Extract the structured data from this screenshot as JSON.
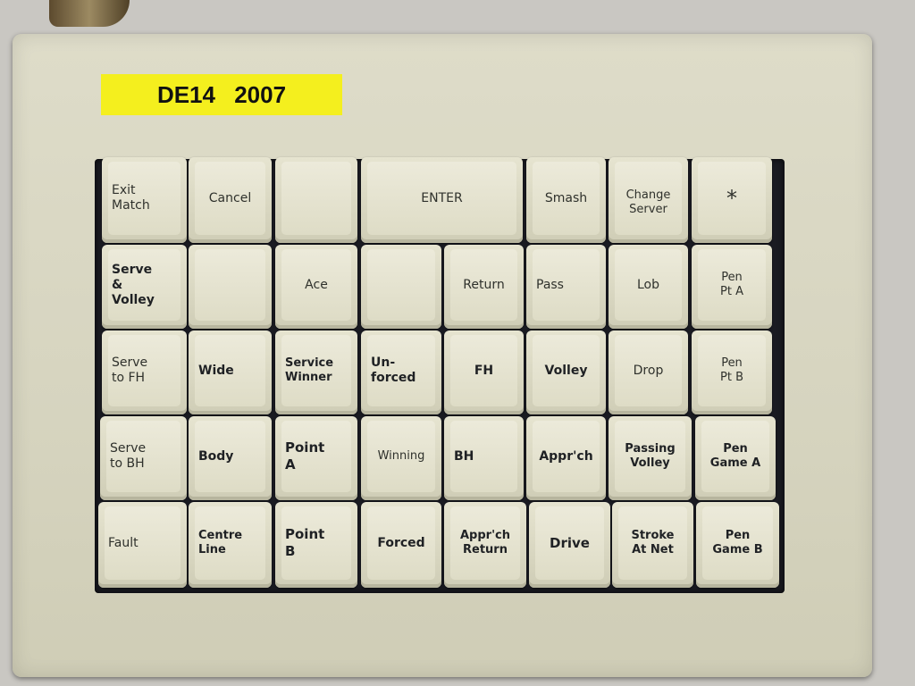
{
  "label": {
    "text": "DE14  2007"
  },
  "keys": {
    "exit_match": {
      "text": "Exit\nMatch",
      "mark": "*"
    },
    "cancel": {
      "text": "Cancel"
    },
    "enter": {
      "text": "ENTER"
    },
    "smash": {
      "text": "Smash"
    },
    "change_server": {
      "text": "Change\nServer",
      "mark": "*"
    },
    "star": {
      "text": "*"
    },
    "serve_volley": {
      "text": "Serve\n&\nVolley"
    },
    "ace": {
      "text": "Ace"
    },
    "return": {
      "text": "Return"
    },
    "pass": {
      "text": "Pass"
    },
    "lob": {
      "text": "Lob"
    },
    "pen_pt_a": {
      "text": "Pen\nPt A"
    },
    "serve_fh": {
      "text": "Serve\nto FH"
    },
    "wide": {
      "text": "Wide"
    },
    "service_winner": {
      "text": "Service\nWinner"
    },
    "unforced": {
      "text": "Un-\nforced"
    },
    "fh": {
      "text": "FH"
    },
    "volley": {
      "text": "Volley"
    },
    "drop": {
      "text": "Drop"
    },
    "pen_pt_b": {
      "text": "Pen\nPt B"
    },
    "serve_bh": {
      "text": "Serve\nto BH"
    },
    "body": {
      "text": "Body"
    },
    "point_a": {
      "text": "Point\nA"
    },
    "winning": {
      "text": "Winning"
    },
    "bh": {
      "text": "BH"
    },
    "approach": {
      "text": "Appr'ch"
    },
    "passing_volley": {
      "text": "Passing\nVolley"
    },
    "pen_game_a": {
      "text": "Pen\nGame A"
    },
    "fault": {
      "text": "Fault"
    },
    "centre_line": {
      "text": "Centre\nLine"
    },
    "point_b": {
      "text": "Point\nB"
    },
    "forced": {
      "text": "Forced"
    },
    "approach_return": {
      "text": "Appr'ch\nReturn"
    },
    "drive": {
      "text": "Drive"
    },
    "stroke_at_net": {
      "text": "Stroke\nAt Net"
    },
    "pen_game_b": {
      "text": "Pen\nGame B"
    }
  }
}
